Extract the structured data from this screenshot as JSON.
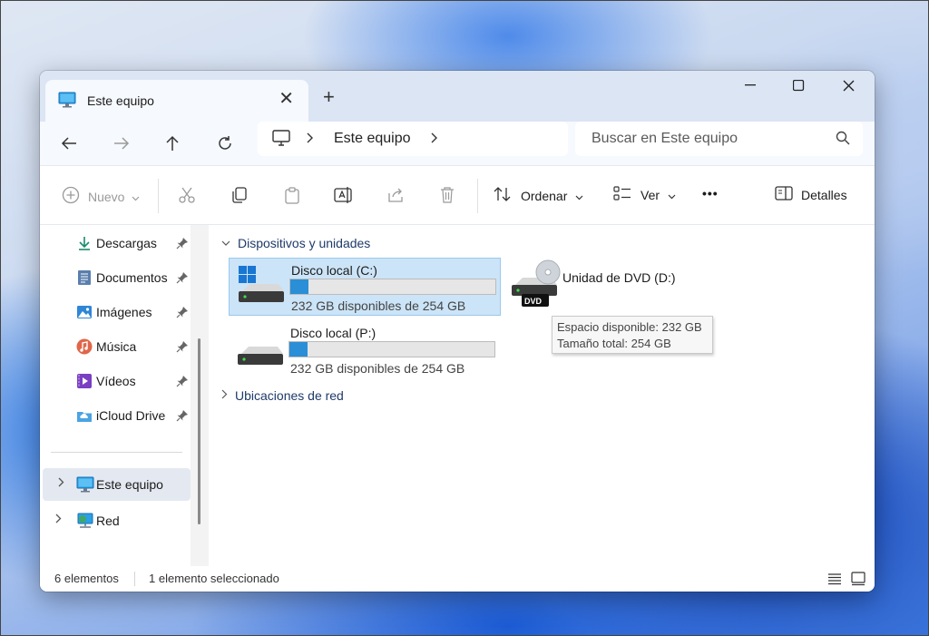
{
  "window": {
    "tab_title": "Este equipo",
    "new_tab": "+",
    "close_tab": "✕"
  },
  "nav": {
    "breadcrumb": "Este equipo",
    "search_placeholder": "Buscar en Este equipo"
  },
  "commands": {
    "new_label": "Nuevo",
    "sort_label": "Ordenar",
    "view_label": "Ver",
    "more_label": "•••",
    "details_label": "Detalles"
  },
  "sidebar": {
    "quick_access": [
      {
        "label": "Descargas",
        "icon": "download-icon"
      },
      {
        "label": "Documentos",
        "icon": "documents-icon"
      },
      {
        "label": "Imágenes",
        "icon": "pictures-icon"
      },
      {
        "label": "Música",
        "icon": "music-icon"
      },
      {
        "label": "Vídeos",
        "icon": "videos-icon"
      },
      {
        "label": "iCloud Drive",
        "icon": "icloud-icon"
      }
    ],
    "this_pc": "Este equipo",
    "network": "Red"
  },
  "content": {
    "group_devices": "Dispositivos y unidades",
    "group_network": "Ubicaciones de red",
    "drives": [
      {
        "name": "Disco local (C:)",
        "free_text": "232 GB disponibles de 254 GB",
        "used_fraction": 0.09,
        "selected": true
      },
      {
        "name": "Disco local (P:)",
        "free_text": "232 GB disponibles de 254 GB",
        "used_fraction": 0.09,
        "selected": false
      }
    ],
    "dvd": {
      "name": "Unidad de DVD (D:)",
      "badge": "DVD"
    },
    "tooltip": {
      "line1": "Espacio disponible: 232 GB",
      "line2": "Tamaño total: 254 GB"
    }
  },
  "status": {
    "item_count": "6 elementos",
    "selected_count": "1 elemento seleccionado"
  },
  "colors": {
    "accent": "#2a8fd6",
    "selection": "#cce4f7",
    "titlebar": "#dbe5f4"
  }
}
